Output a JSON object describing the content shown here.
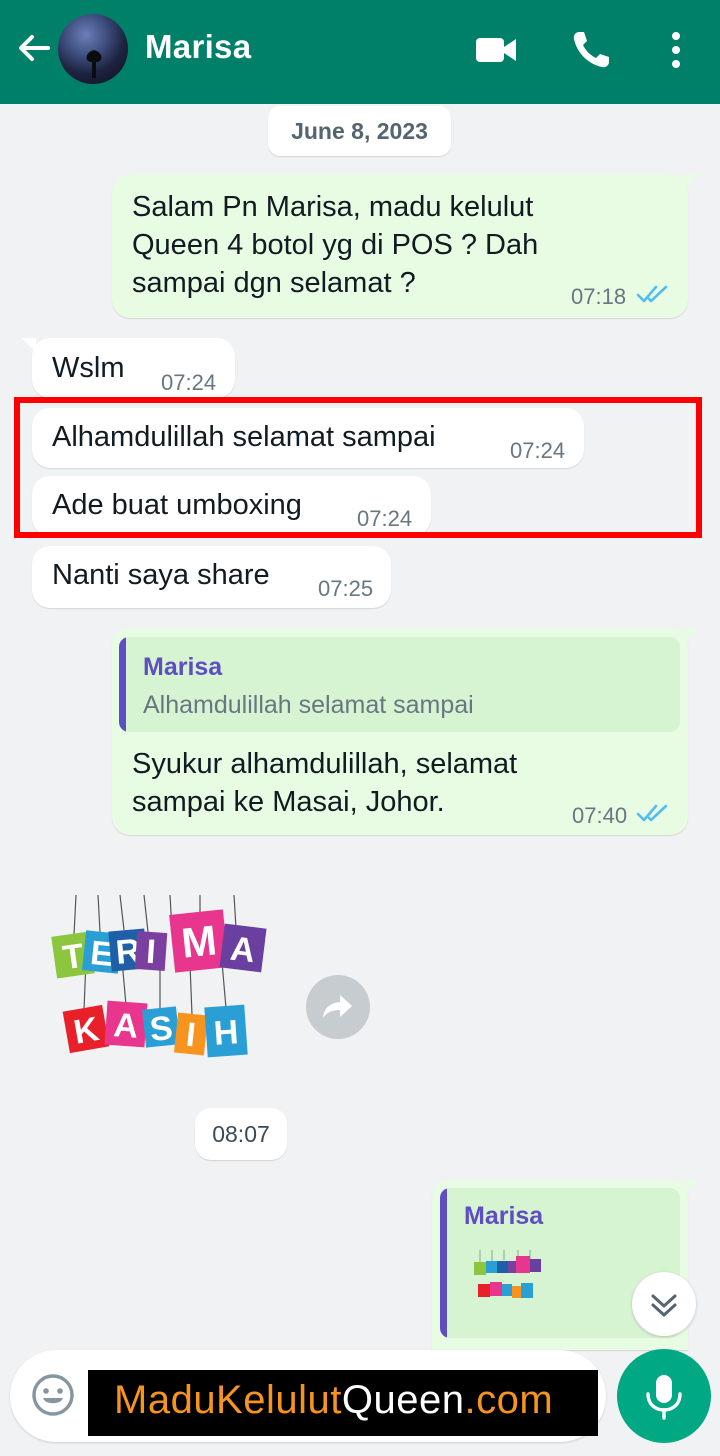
{
  "header": {
    "contact_name": "Marisa"
  },
  "chat": {
    "date_chip": "June 8, 2023",
    "messages": [
      {
        "direction": "out",
        "text_lines": [
          "Salam Pn Marisa, madu kelulut",
          "Queen 4 botol yg di POS ? Dah",
          "sampai dgn selamat ?"
        ],
        "time": "07:18",
        "status": "read"
      },
      {
        "direction": "in",
        "text": "Wslm",
        "time": "07:24"
      },
      {
        "direction": "in",
        "text": "Alhamdulillah selamat sampai",
        "time": "07:24"
      },
      {
        "direction": "in",
        "text": "Ade buat umboxing",
        "time": "07:24"
      },
      {
        "direction": "in",
        "text": "Nanti saya share",
        "time": "07:25"
      },
      {
        "direction": "out",
        "quote_name": "Marisa",
        "quote_text": "Alhamdulillah selamat sampai",
        "text_lines": [
          "Syukur alhamdulillah, selamat",
          "sampai ke Masai, Johor."
        ],
        "time": "07:40",
        "status": "read"
      },
      {
        "direction": "in",
        "type": "sticker",
        "sticker_lines": [
          "TERIMA",
          "KASIH"
        ]
      },
      {
        "direction": "out",
        "quote_name": "Marisa",
        "quote_type": "sticker"
      }
    ],
    "time_chip": "08:07"
  },
  "watermark": {
    "part1": "MaduKelulut",
    "part2": "Queen",
    "part3": ".com"
  },
  "colors": {
    "header": "#008069",
    "outgoing_bubble": "#e7fce3",
    "incoming_bubble": "#ffffff",
    "tick_blue": "#53bdeb",
    "quote_accent": "#5f4ec2",
    "mic_button": "#00a884",
    "highlight_box": "#ff0000"
  },
  "icons": [
    "back-arrow-icon",
    "video-call-icon",
    "phone-icon",
    "more-vert-icon",
    "forward-icon",
    "double-chevron-down-icon",
    "emoji-icon",
    "mic-icon",
    "double-check-icon"
  ]
}
